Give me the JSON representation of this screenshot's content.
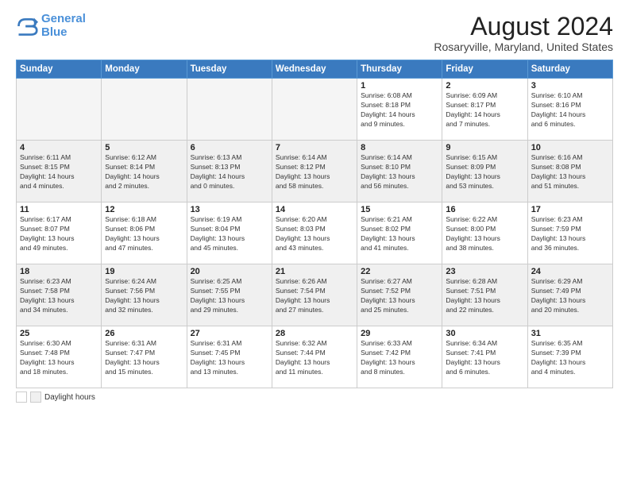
{
  "header": {
    "logo_line1": "General",
    "logo_line2": "Blue",
    "main_title": "August 2024",
    "subtitle": "Rosaryville, Maryland, United States"
  },
  "weekdays": [
    "Sunday",
    "Monday",
    "Tuesday",
    "Wednesday",
    "Thursday",
    "Friday",
    "Saturday"
  ],
  "weeks": [
    [
      {
        "day": "",
        "info": "",
        "empty": true
      },
      {
        "day": "",
        "info": "",
        "empty": true
      },
      {
        "day": "",
        "info": "",
        "empty": true
      },
      {
        "day": "",
        "info": "",
        "empty": true
      },
      {
        "day": "1",
        "info": "Sunrise: 6:08 AM\nSunset: 8:18 PM\nDaylight: 14 hours\nand 9 minutes."
      },
      {
        "day": "2",
        "info": "Sunrise: 6:09 AM\nSunset: 8:17 PM\nDaylight: 14 hours\nand 7 minutes."
      },
      {
        "day": "3",
        "info": "Sunrise: 6:10 AM\nSunset: 8:16 PM\nDaylight: 14 hours\nand 6 minutes."
      }
    ],
    [
      {
        "day": "4",
        "info": "Sunrise: 6:11 AM\nSunset: 8:15 PM\nDaylight: 14 hours\nand 4 minutes.",
        "shaded": true
      },
      {
        "day": "5",
        "info": "Sunrise: 6:12 AM\nSunset: 8:14 PM\nDaylight: 14 hours\nand 2 minutes.",
        "shaded": true
      },
      {
        "day": "6",
        "info": "Sunrise: 6:13 AM\nSunset: 8:13 PM\nDaylight: 14 hours\nand 0 minutes.",
        "shaded": true
      },
      {
        "day": "7",
        "info": "Sunrise: 6:14 AM\nSunset: 8:12 PM\nDaylight: 13 hours\nand 58 minutes.",
        "shaded": true
      },
      {
        "day": "8",
        "info": "Sunrise: 6:14 AM\nSunset: 8:10 PM\nDaylight: 13 hours\nand 56 minutes.",
        "shaded": true
      },
      {
        "day": "9",
        "info": "Sunrise: 6:15 AM\nSunset: 8:09 PM\nDaylight: 13 hours\nand 53 minutes.",
        "shaded": true
      },
      {
        "day": "10",
        "info": "Sunrise: 6:16 AM\nSunset: 8:08 PM\nDaylight: 13 hours\nand 51 minutes.",
        "shaded": true
      }
    ],
    [
      {
        "day": "11",
        "info": "Sunrise: 6:17 AM\nSunset: 8:07 PM\nDaylight: 13 hours\nand 49 minutes."
      },
      {
        "day": "12",
        "info": "Sunrise: 6:18 AM\nSunset: 8:06 PM\nDaylight: 13 hours\nand 47 minutes."
      },
      {
        "day": "13",
        "info": "Sunrise: 6:19 AM\nSunset: 8:04 PM\nDaylight: 13 hours\nand 45 minutes."
      },
      {
        "day": "14",
        "info": "Sunrise: 6:20 AM\nSunset: 8:03 PM\nDaylight: 13 hours\nand 43 minutes."
      },
      {
        "day": "15",
        "info": "Sunrise: 6:21 AM\nSunset: 8:02 PM\nDaylight: 13 hours\nand 41 minutes."
      },
      {
        "day": "16",
        "info": "Sunrise: 6:22 AM\nSunset: 8:00 PM\nDaylight: 13 hours\nand 38 minutes."
      },
      {
        "day": "17",
        "info": "Sunrise: 6:23 AM\nSunset: 7:59 PM\nDaylight: 13 hours\nand 36 minutes."
      }
    ],
    [
      {
        "day": "18",
        "info": "Sunrise: 6:23 AM\nSunset: 7:58 PM\nDaylight: 13 hours\nand 34 minutes.",
        "shaded": true
      },
      {
        "day": "19",
        "info": "Sunrise: 6:24 AM\nSunset: 7:56 PM\nDaylight: 13 hours\nand 32 minutes.",
        "shaded": true
      },
      {
        "day": "20",
        "info": "Sunrise: 6:25 AM\nSunset: 7:55 PM\nDaylight: 13 hours\nand 29 minutes.",
        "shaded": true
      },
      {
        "day": "21",
        "info": "Sunrise: 6:26 AM\nSunset: 7:54 PM\nDaylight: 13 hours\nand 27 minutes.",
        "shaded": true
      },
      {
        "day": "22",
        "info": "Sunrise: 6:27 AM\nSunset: 7:52 PM\nDaylight: 13 hours\nand 25 minutes.",
        "shaded": true
      },
      {
        "day": "23",
        "info": "Sunrise: 6:28 AM\nSunset: 7:51 PM\nDaylight: 13 hours\nand 22 minutes.",
        "shaded": true
      },
      {
        "day": "24",
        "info": "Sunrise: 6:29 AM\nSunset: 7:49 PM\nDaylight: 13 hours\nand 20 minutes.",
        "shaded": true
      }
    ],
    [
      {
        "day": "25",
        "info": "Sunrise: 6:30 AM\nSunset: 7:48 PM\nDaylight: 13 hours\nand 18 minutes."
      },
      {
        "day": "26",
        "info": "Sunrise: 6:31 AM\nSunset: 7:47 PM\nDaylight: 13 hours\nand 15 minutes."
      },
      {
        "day": "27",
        "info": "Sunrise: 6:31 AM\nSunset: 7:45 PM\nDaylight: 13 hours\nand 13 minutes."
      },
      {
        "day": "28",
        "info": "Sunrise: 6:32 AM\nSunset: 7:44 PM\nDaylight: 13 hours\nand 11 minutes."
      },
      {
        "day": "29",
        "info": "Sunrise: 6:33 AM\nSunset: 7:42 PM\nDaylight: 13 hours\nand 8 minutes."
      },
      {
        "day": "30",
        "info": "Sunrise: 6:34 AM\nSunset: 7:41 PM\nDaylight: 13 hours\nand 6 minutes."
      },
      {
        "day": "31",
        "info": "Sunrise: 6:35 AM\nSunset: 7:39 PM\nDaylight: 13 hours\nand 4 minutes."
      }
    ]
  ],
  "footer": {
    "legend_label": "Daylight hours"
  }
}
